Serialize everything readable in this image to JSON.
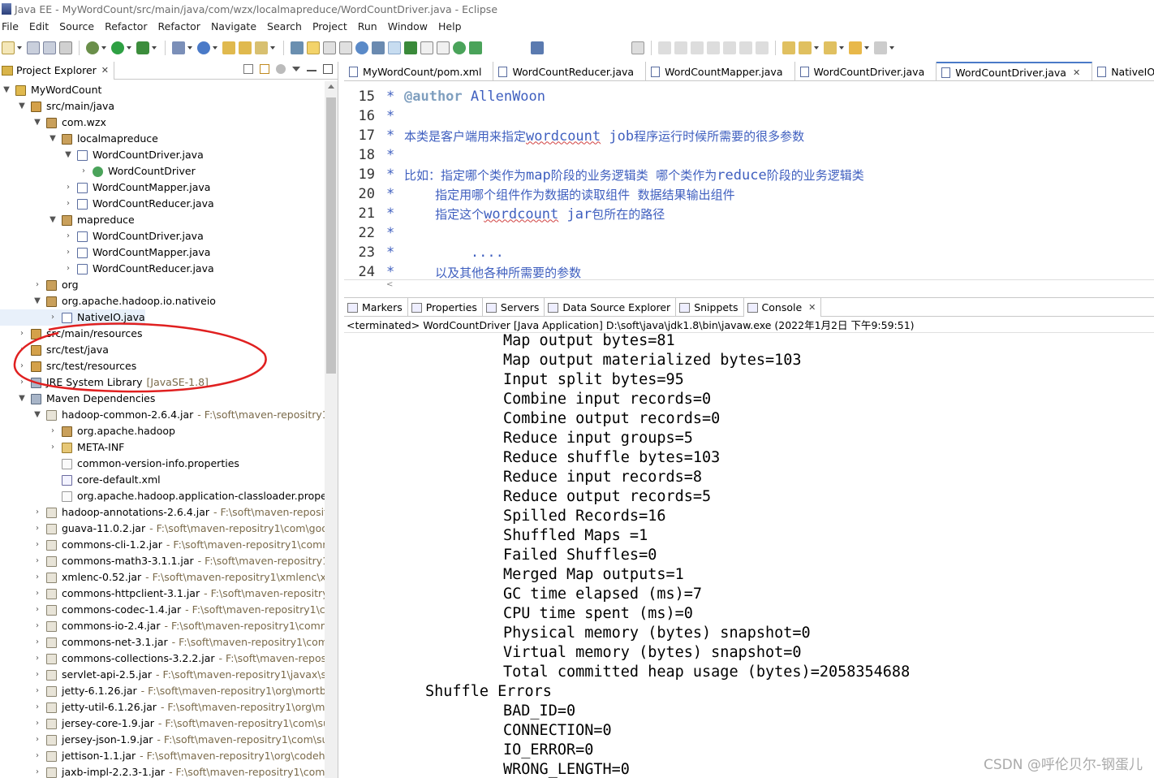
{
  "window": {
    "title": "Java EE - MyWordCount/src/main/java/com/wzx/localmapreduce/WordCountDriver.java - Eclipse"
  },
  "menu": [
    "File",
    "Edit",
    "Source",
    "Refactor",
    "Refactor",
    "Navigate",
    "Search",
    "Project",
    "Run",
    "Window",
    "Help"
  ],
  "left_panel": {
    "tab_label": "Project Explorer",
    "tree": [
      {
        "label": "MyWordCount",
        "icon": "project-icon",
        "arrow": "▼",
        "indent": 0
      },
      {
        "label": "src/main/java",
        "icon": "source-folder-icon",
        "arrow": "▼",
        "indent": 1
      },
      {
        "label": "com.wzx",
        "icon": "package-icon",
        "arrow": "▼",
        "indent": 2
      },
      {
        "label": "localmapreduce",
        "icon": "package-icon",
        "arrow": "▼",
        "indent": 3
      },
      {
        "label": "WordCountDriver.java",
        "icon": "java-file-icon",
        "arrow": "▼",
        "indent": 4
      },
      {
        "label": "WordCountDriver",
        "icon": "class-icon",
        "arrow": "›",
        "indent": 5
      },
      {
        "label": "WordCountMapper.java",
        "icon": "java-file-icon",
        "arrow": "›",
        "indent": 4
      },
      {
        "label": "WordCountReducer.java",
        "icon": "java-file-icon",
        "arrow": "›",
        "indent": 4
      },
      {
        "label": "mapreduce",
        "icon": "package-icon",
        "arrow": "▼",
        "indent": 3
      },
      {
        "label": "WordCountDriver.java",
        "icon": "java-file-icon",
        "arrow": "›",
        "indent": 4
      },
      {
        "label": "WordCountMapper.java",
        "icon": "java-file-icon",
        "arrow": "›",
        "indent": 4
      },
      {
        "label": "WordCountReducer.java",
        "icon": "java-file-icon",
        "arrow": "›",
        "indent": 4
      },
      {
        "label": "org",
        "icon": "package-icon",
        "arrow": "›",
        "indent": 2
      },
      {
        "label": "org.apache.hadoop.io.nativeio",
        "icon": "package-icon",
        "arrow": "▼",
        "indent": 2
      },
      {
        "label": "NativeIO.java",
        "icon": "java-file-icon",
        "arrow": "›",
        "indent": 3,
        "selected": true
      },
      {
        "label": "src/main/resources",
        "icon": "source-folder-icon",
        "arrow": "›",
        "indent": 1
      },
      {
        "label": "src/test/java",
        "icon": "source-folder-icon",
        "arrow": "›",
        "indent": 1
      },
      {
        "label": "src/test/resources",
        "icon": "source-folder-icon",
        "arrow": "›",
        "indent": 1
      },
      {
        "label": "JRE System Library",
        "decoration": "[JavaSE-1.8]",
        "icon": "library-icon",
        "arrow": "›",
        "indent": 1
      },
      {
        "label": "Maven Dependencies",
        "icon": "library-icon",
        "arrow": "▼",
        "indent": 1
      },
      {
        "label": "hadoop-common-2.6.4.jar",
        "decoration": "- F:\\soft\\maven-repositry1\\o",
        "icon": "jar-icon",
        "arrow": "▼",
        "indent": 2
      },
      {
        "label": "org.apache.hadoop",
        "icon": "package-icon",
        "arrow": "›",
        "indent": 3
      },
      {
        "label": "META-INF",
        "icon": "folder-icon",
        "arrow": "›",
        "indent": 3
      },
      {
        "label": "common-version-info.properties",
        "icon": "file-icon",
        "arrow": "",
        "indent": 3
      },
      {
        "label": "core-default.xml",
        "icon": "xml-file-icon",
        "arrow": "",
        "indent": 3
      },
      {
        "label": "org.apache.hadoop.application-classloader.propert",
        "icon": "file-icon",
        "arrow": "",
        "indent": 3
      },
      {
        "label": "hadoop-annotations-2.6.4.jar",
        "decoration": "- F:\\soft\\maven-repositry",
        "icon": "jar-icon",
        "arrow": "›",
        "indent": 2
      },
      {
        "label": "guava-11.0.2.jar",
        "decoration": "- F:\\soft\\maven-repositry1\\com\\google",
        "icon": "jar-icon",
        "arrow": "›",
        "indent": 2
      },
      {
        "label": "commons-cli-1.2.jar",
        "decoration": "- F:\\soft\\maven-repositry1\\commo",
        "icon": "jar-icon",
        "arrow": "›",
        "indent": 2
      },
      {
        "label": "commons-math3-3.1.1.jar",
        "decoration": "- F:\\soft\\maven-repositry1\\or",
        "icon": "jar-icon",
        "arrow": "›",
        "indent": 2
      },
      {
        "label": "xmlenc-0.52.jar",
        "decoration": "- F:\\soft\\maven-repositry1\\xmlenc\\xmle",
        "icon": "jar-icon",
        "arrow": "›",
        "indent": 2
      },
      {
        "label": "commons-httpclient-3.1.jar",
        "decoration": "- F:\\soft\\maven-repositry1\\c",
        "icon": "jar-icon",
        "arrow": "›",
        "indent": 2
      },
      {
        "label": "commons-codec-1.4.jar",
        "decoration": "- F:\\soft\\maven-repositry1\\com",
        "icon": "jar-icon",
        "arrow": "›",
        "indent": 2
      },
      {
        "label": "commons-io-2.4.jar",
        "decoration": "- F:\\soft\\maven-repositry1\\commo",
        "icon": "jar-icon",
        "arrow": "›",
        "indent": 2
      },
      {
        "label": "commons-net-3.1.jar",
        "decoration": "- F:\\soft\\maven-repositry1\\comm",
        "icon": "jar-icon",
        "arrow": "›",
        "indent": 2
      },
      {
        "label": "commons-collections-3.2.2.jar",
        "decoration": "- F:\\soft\\maven-repositry",
        "icon": "jar-icon",
        "arrow": "›",
        "indent": 2
      },
      {
        "label": "servlet-api-2.5.jar",
        "decoration": "- F:\\soft\\maven-repositry1\\javax\\serv",
        "icon": "jar-icon",
        "arrow": "›",
        "indent": 2
      },
      {
        "label": "jetty-6.1.26.jar",
        "decoration": "- F:\\soft\\maven-repositry1\\org\\mortbay\\",
        "icon": "jar-icon",
        "arrow": "›",
        "indent": 2
      },
      {
        "label": "jetty-util-6.1.26.jar",
        "decoration": "- F:\\soft\\maven-repositry1\\org\\mortl",
        "icon": "jar-icon",
        "arrow": "›",
        "indent": 2
      },
      {
        "label": "jersey-core-1.9.jar",
        "decoration": "- F:\\soft\\maven-repositry1\\com\\sun\\",
        "icon": "jar-icon",
        "arrow": "›",
        "indent": 2
      },
      {
        "label": "jersey-json-1.9.jar",
        "decoration": "- F:\\soft\\maven-repositry1\\com\\sun\\j",
        "icon": "jar-icon",
        "arrow": "›",
        "indent": 2
      },
      {
        "label": "jettison-1.1.jar",
        "decoration": "- F:\\soft\\maven-repositry1\\org\\codehau",
        "icon": "jar-icon",
        "arrow": "›",
        "indent": 2
      },
      {
        "label": "jaxb-impl-2.2.3-1.jar",
        "decoration": "- F:\\soft\\maven-repositry1\\com\\su",
        "icon": "jar-icon",
        "arrow": "›",
        "indent": 2
      }
    ]
  },
  "editor": {
    "tabs": [
      {
        "label": "MyWordCount/pom.xml",
        "active": false
      },
      {
        "label": "WordCountReducer.java",
        "active": false
      },
      {
        "label": "WordCountMapper.java",
        "active": false
      },
      {
        "label": "WordCountDriver.java",
        "active": false
      },
      {
        "label": "WordCountDriver.java",
        "active": true
      },
      {
        "label": "NativeIO",
        "active": false
      }
    ],
    "lines": [
      {
        "num": "15",
        "star": "*",
        "parts": [
          {
            "t": "@author",
            "c": "tag"
          },
          {
            "t": " AllenWoon",
            "c": "mono"
          }
        ]
      },
      {
        "num": "16",
        "star": "*",
        "parts": []
      },
      {
        "num": "17",
        "star": "*",
        "parts": [
          {
            "t": "本类是客户端用来指定",
            "c": ""
          },
          {
            "t": "wordcount",
            "c": "mono sq"
          },
          {
            "t": " job",
            "c": "mono"
          },
          {
            "t": "程序运行时候所需要的很多参数",
            "c": ""
          }
        ]
      },
      {
        "num": "18",
        "star": "*",
        "parts": []
      },
      {
        "num": "19",
        "star": "*",
        "parts": [
          {
            "t": "比如：指定哪个类作为",
            "c": ""
          },
          {
            "t": "map",
            "c": "mono"
          },
          {
            "t": "阶段的业务逻辑类  哪个类作为",
            "c": ""
          },
          {
            "t": "reduce",
            "c": "mono"
          },
          {
            "t": "阶段的业务逻辑类",
            "c": ""
          }
        ]
      },
      {
        "num": "20",
        "star": "*",
        "parts": [
          {
            "t": "        指定用哪个组件作为数据的读取组件  数据结果输出组件",
            "c": ""
          }
        ]
      },
      {
        "num": "21",
        "star": "*",
        "parts": [
          {
            "t": "        指定这个",
            "c": ""
          },
          {
            "t": "wordcount",
            "c": "mono sq"
          },
          {
            "t": " jar",
            "c": "mono"
          },
          {
            "t": "包所在的路径",
            "c": ""
          }
        ]
      },
      {
        "num": "22",
        "star": "*",
        "parts": []
      },
      {
        "num": "23",
        "star": "*",
        "parts": [
          {
            "t": "        ....",
            "c": "mono"
          }
        ]
      },
      {
        "num": "24",
        "star": "*",
        "parts": [
          {
            "t": "        以及其他各种所需要的参数",
            "c": ""
          }
        ]
      }
    ]
  },
  "console": {
    "tabs": [
      {
        "label": "Markers",
        "active": false
      },
      {
        "label": "Properties",
        "active": false
      },
      {
        "label": "Servers",
        "active": false
      },
      {
        "label": "Data Source Explorer",
        "active": false
      },
      {
        "label": "Snippets",
        "active": false
      },
      {
        "label": "Console",
        "active": true
      }
    ],
    "status": "<terminated> WordCountDriver [Java Application] D:\\soft\\java\\jdk1.8\\bin\\javaw.exe (2022年1月2日 下午9:59:51)",
    "output": [
      {
        "text": "Map output bytes=81",
        "indent": 2
      },
      {
        "text": "Map output materialized bytes=103",
        "indent": 2
      },
      {
        "text": "Input split bytes=95",
        "indent": 2
      },
      {
        "text": "Combine input records=0",
        "indent": 2
      },
      {
        "text": "Combine output records=0",
        "indent": 2
      },
      {
        "text": "Reduce input groups=5",
        "indent": 2
      },
      {
        "text": "Reduce shuffle bytes=103",
        "indent": 2
      },
      {
        "text": "Reduce input records=8",
        "indent": 2
      },
      {
        "text": "Reduce output records=5",
        "indent": 2
      },
      {
        "text": "Spilled Records=16",
        "indent": 2
      },
      {
        "text": "Shuffled Maps =1",
        "indent": 2
      },
      {
        "text": "Failed Shuffles=0",
        "indent": 2
      },
      {
        "text": "Merged Map outputs=1",
        "indent": 2
      },
      {
        "text": "GC time elapsed (ms)=7",
        "indent": 2
      },
      {
        "text": "CPU time spent (ms)=0",
        "indent": 2
      },
      {
        "text": "Physical memory (bytes) snapshot=0",
        "indent": 2
      },
      {
        "text": "Virtual memory (bytes) snapshot=0",
        "indent": 2
      },
      {
        "text": "Total committed heap usage (bytes)=2058354688",
        "indent": 2
      },
      {
        "text": "Shuffle Errors",
        "indent": 1
      },
      {
        "text": "BAD_ID=0",
        "indent": 2
      },
      {
        "text": "CONNECTION=0",
        "indent": 2
      },
      {
        "text": "IO_ERROR=0",
        "indent": 2
      },
      {
        "text": "WRONG_LENGTH=0",
        "indent": 2
      }
    ]
  },
  "watermark": "CSDN @呼伦贝尔-钢蛋儿",
  "colors": {
    "annotation_ellipse": "#e02020",
    "comment": "#3f5fbf",
    "javadoc_tag": "#7f9fbf",
    "active_tab_accent": "#4a7ac8"
  }
}
